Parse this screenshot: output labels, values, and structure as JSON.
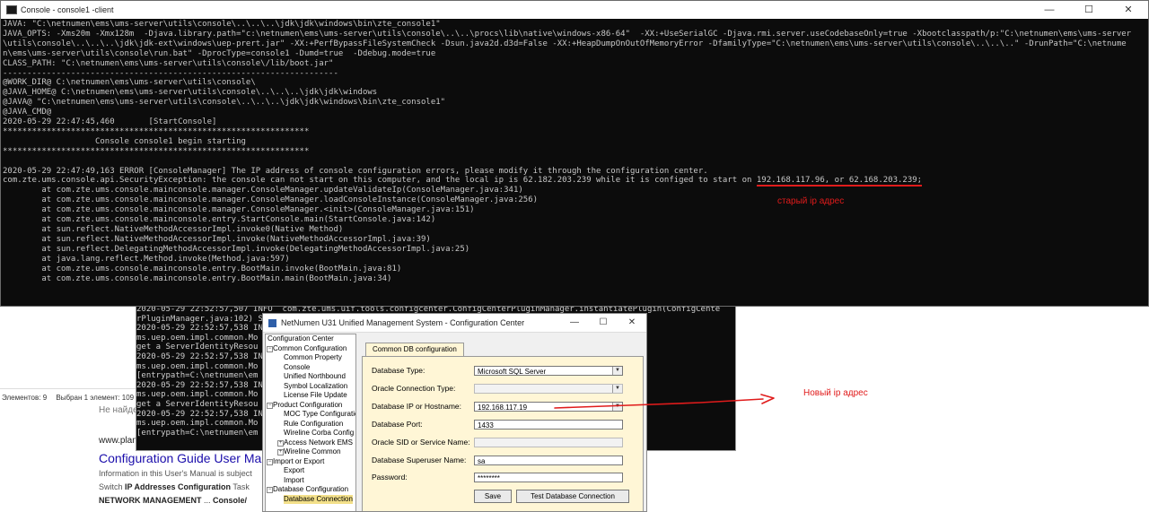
{
  "explorer_status": {
    "items": "Элементов: 9",
    "selected": "Выбран 1 элемент: 109"
  },
  "web": {
    "not_found": "Не найде",
    "url": "www.plan",
    "result_title": "Configuration Guide User Man",
    "snippet_1": "Information in this User's Manual is subject",
    "snippet_2a": "Switch ",
    "snippet_2b": "IP Addresses Configuration",
    "snippet_2c": " Task",
    "snippet_3a": "NETWORK MANAGEMENT",
    "snippet_3b": " ... ",
    "snippet_3c": "Console/"
  },
  "console2": {
    "lines": [
      "2020-05-29 22:52:57,507 INFO  com.zte.ums.uif.tools.configcenter.ConfigCenterPluginManager.instantiatePlugin(ConfigCente",
      "rPluginManager.java:102) S                                                                ImportConfig",
      "2020-05-29 22:52:57,538 IN                                                              :192) [com.zte.u",
      "ms.uep.oem.impl.common.Mo                                                               dentityResource]",
      "get a ServerIdentityResou",
      "2020-05-29 22:52:57,538 IN                                                              :192) [com.zte.u",
      "ms.uep.oem.impl.common.Mo                                                               dentityResource]",
      "[entrypath=C:\\netnumen\\em",
      "2020-05-29 22:52:57,538 IN                                                              :192) [com.zte.u",
      "ms.uep.oem.impl.common.Mo                                                               dentityResource]",
      "get a ServerIdentityResou",
      "2020-05-29 22:52:57,538 IN                                                              :192) [com.zte.u",
      "ms.uep.oem.impl.common.Mo                                                               dentityResource]",
      "[entrypath=C:\\netnumen\\em"
    ]
  },
  "console1": {
    "title": "Console - console1 -client",
    "min": "—",
    "max": "☐",
    "close": "✕",
    "lines": [
      "JAVA: \"C:\\netnumen\\ems\\ums-server\\utils\\console\\..\\..\\..\\jdk\\jdk\\windows\\bin\\zte_console1\"",
      "JAVA_OPTS: -Xms20m -Xmx128m  -Djava.library.path=\"c:\\netnumen\\ems\\ums-server\\utils\\console\\..\\..\\procs\\lib\\native\\windows-x86-64\"  -XX:+UseSerialGC -Djava.rmi.server.useCodebaseOnly=true -Xbootclasspath/p:\"C:\\netnumen\\ems\\ums-server",
      "\\utils\\console\\..\\..\\..\\jdk\\jdk-ext\\windows\\uep-prert.jar\" -XX:+PerfBypassFileSystemCheck -Dsun.java2d.d3d=False -XX:+HeapDumpOnOutOfMemoryError -DfamilyType=\"C:\\netnumen\\ems\\ums-server\\utils\\console\\..\\..\\..\" -DrunPath=\"C:\\netnume",
      "n\\ems\\ums-server\\utils\\console\\run.bat\" -DprocType=console1 -Dumd=true  -Ddebug.mode=true",
      "CLASS_PATH: \"C:\\netnumen\\ems\\ums-server\\utils\\console\\/lib/boot.jar\"",
      "---------------------------------------------------------------------",
      "@WORK_DIR@ C:\\netnumen\\ems\\ums-server\\utils\\console\\",
      "@JAVA_HOME@ C:\\netnumen\\ems\\ums-server\\utils\\console\\..\\..\\..\\jdk\\jdk\\windows",
      "@JAVA@ \"C:\\netnumen\\ems\\ums-server\\utils\\console\\..\\..\\..\\jdk\\jdk\\windows\\bin\\zte_console1\"",
      "@JAVA_CMD@",
      "2020-05-29 22:47:45,460       [StartConsole]",
      "***************************************************************",
      "                   Console console1 begin starting",
      "***************************************************************",
      "",
      "2020-05-29 22:47:49,163 ERROR [ConsoleManager] The IP address of console configuration errors, please modify it through the configuration center.",
      "com.zte.ums.console.api.SecurityException: the console can not start on this computer, and the local ip is 62.182.203.239 while it is configed to start on ",
      "        at com.zte.ums.console.mainconsole.manager.ConsoleManager.updateValidateIp(ConsoleManager.java:341)",
      "        at com.zte.ums.console.mainconsole.manager.ConsoleManager.loadConsoleInstance(ConsoleManager.java:256)",
      "        at com.zte.ums.console.mainconsole.manager.ConsoleManager.<init>(ConsoleManager.java:151)",
      "        at com.zte.ums.console.mainconsole.entry.StartConsole.main(StartConsole.java:142)",
      "        at sun.reflect.NativeMethodAccessorImpl.invoke0(Native Method)",
      "        at sun.reflect.NativeMethodAccessorImpl.invoke(NativeMethodAccessorImpl.java:39)",
      "        at sun.reflect.DelegatingMethodAccessorImpl.invoke(DelegatingMethodAccessorImpl.java:25)",
      "        at java.lang.reflect.Method.invoke(Method.java:597)",
      "        at com.zte.ums.console.mainconsole.entry.BootMain.invoke(BootMain.java:81)",
      "        at com.zte.ums.console.mainconsole.entry.BootMain.main(BootMain.java:34)"
    ],
    "ip_highlight": "192.168.117.96, or 62.168.203.239;"
  },
  "config_center": {
    "title": "NetNumen U31 Unified Management System - Configuration Center",
    "min": "—",
    "max": "☐",
    "close": "✕",
    "tree": [
      {
        "label": "Configuration Center",
        "level": 0,
        "box": ""
      },
      {
        "label": "Common Configuration",
        "level": 1,
        "box": "−"
      },
      {
        "label": "Common Property",
        "level": 2,
        "box": ""
      },
      {
        "label": "Console",
        "level": 2,
        "box": ""
      },
      {
        "label": "Unified Northbound",
        "level": 2,
        "box": ""
      },
      {
        "label": "Symbol Localization",
        "level": 2,
        "box": ""
      },
      {
        "label": "License File Update",
        "level": 2,
        "box": ""
      },
      {
        "label": "Product Configuration",
        "level": 1,
        "box": "−"
      },
      {
        "label": "MOC Type Configuration",
        "level": 2,
        "box": ""
      },
      {
        "label": "Rule Configuration",
        "level": 2,
        "box": ""
      },
      {
        "label": "Wireline Corba Config",
        "level": 2,
        "box": ""
      },
      {
        "label": "Access Network EMS",
        "level": 2,
        "box": "+"
      },
      {
        "label": "Wireline Common",
        "level": 2,
        "box": "+"
      },
      {
        "label": "Import or Export",
        "level": 1,
        "box": "−"
      },
      {
        "label": "Export",
        "level": 2,
        "box": ""
      },
      {
        "label": "Import",
        "level": 2,
        "box": ""
      },
      {
        "label": "Database Configuration",
        "level": 1,
        "box": "−"
      },
      {
        "label": "Database Connection",
        "level": 2,
        "box": "",
        "selected": true
      }
    ],
    "tab": "Common DB configuration",
    "fields": {
      "db_type_label": "Database Type:",
      "db_type_value": "Microsoft SQL Server",
      "oracle_type_label": "Oracle Connection Type:",
      "db_ip_label": "Database IP or Hostname:",
      "db_ip_value": "192.168.117.19",
      "db_port_label": "Database Port:",
      "db_port_value": "1433",
      "oracle_sid_label": "Oracle SID or Service Name:",
      "superuser_label": "Database Superuser Name:",
      "superuser_value": "sa",
      "password_label": "Password:",
      "password_value": "********"
    },
    "save_label": "Save",
    "test_label": "Test Database Connection"
  },
  "annotations": {
    "old_ip": "старый ip адрес",
    "new_ip": "Новый ip адрес",
    "color": "#e01b1b"
  }
}
